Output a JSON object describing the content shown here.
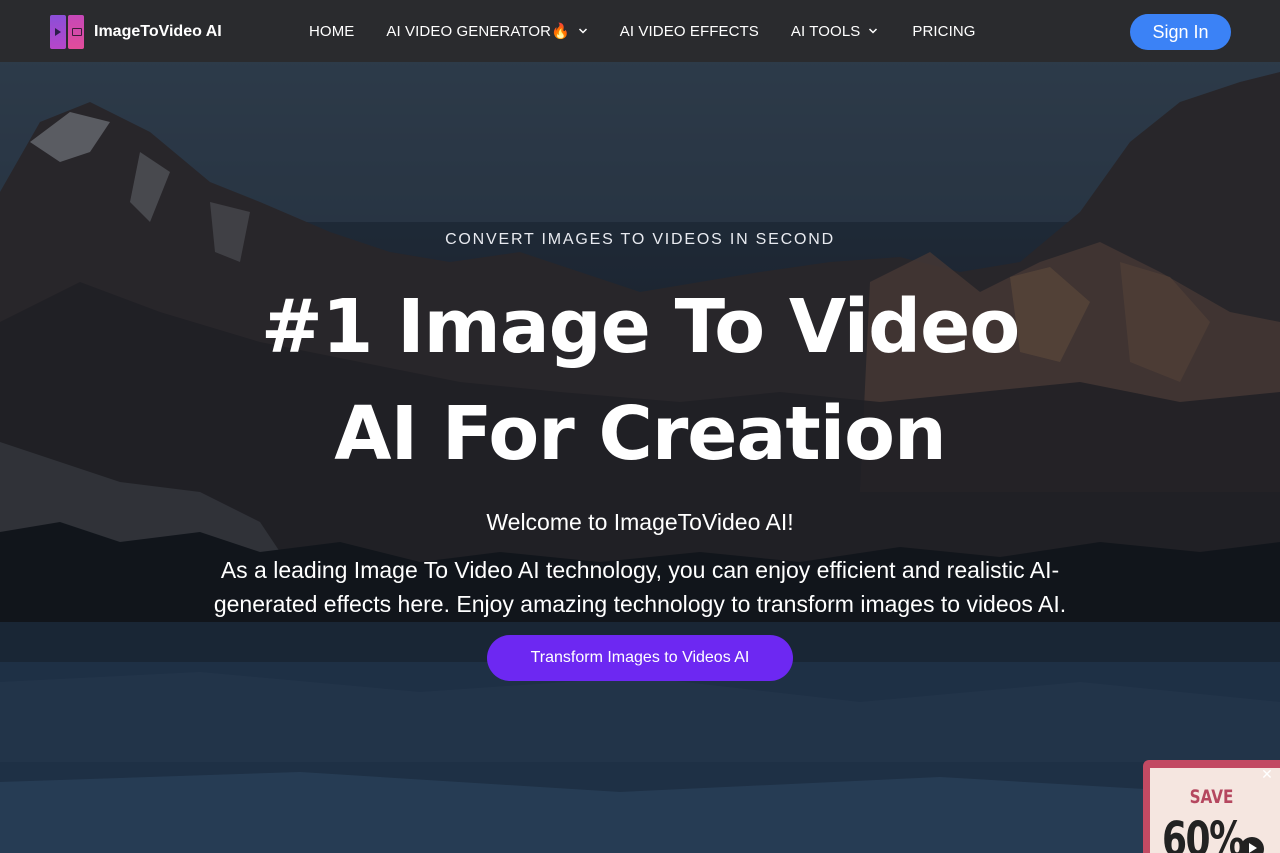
{
  "brand": {
    "name": "ImageToVideo AI",
    "logo_icon": "film-split-icon"
  },
  "nav": {
    "home": "HOME",
    "ai_video_generator": "AI VIDEO GENERATOR🔥",
    "ai_video_effects": "AI VIDEO EFFECTS",
    "ai_tools": "AI TOOLS",
    "pricing": "PRICING"
  },
  "header": {
    "signin_label": "Sign In"
  },
  "hero": {
    "eyebrow": "CONVERT IMAGES TO VIDEOS IN SECOND",
    "title_line1": "#1 Image To Video",
    "title_line2": "AI For Creation",
    "welcome": "Welcome to ImageToVideo AI!",
    "description": "As a leading Image To Video AI technology, you can enjoy efficient and realistic AI-generated effects here. Enjoy amazing technology to transform images to videos AI.",
    "cta_label": "Transform Images to Videos AI"
  },
  "promo": {
    "save": "SAVE",
    "percent": "60%",
    "close": "✕"
  },
  "colors": {
    "header_bg": "#2a2b2e",
    "signin_bg": "#3b82f6",
    "cta_bg": "#6d28f2",
    "promo_border": "#c24a63",
    "promo_bg": "#f5e6e0"
  }
}
